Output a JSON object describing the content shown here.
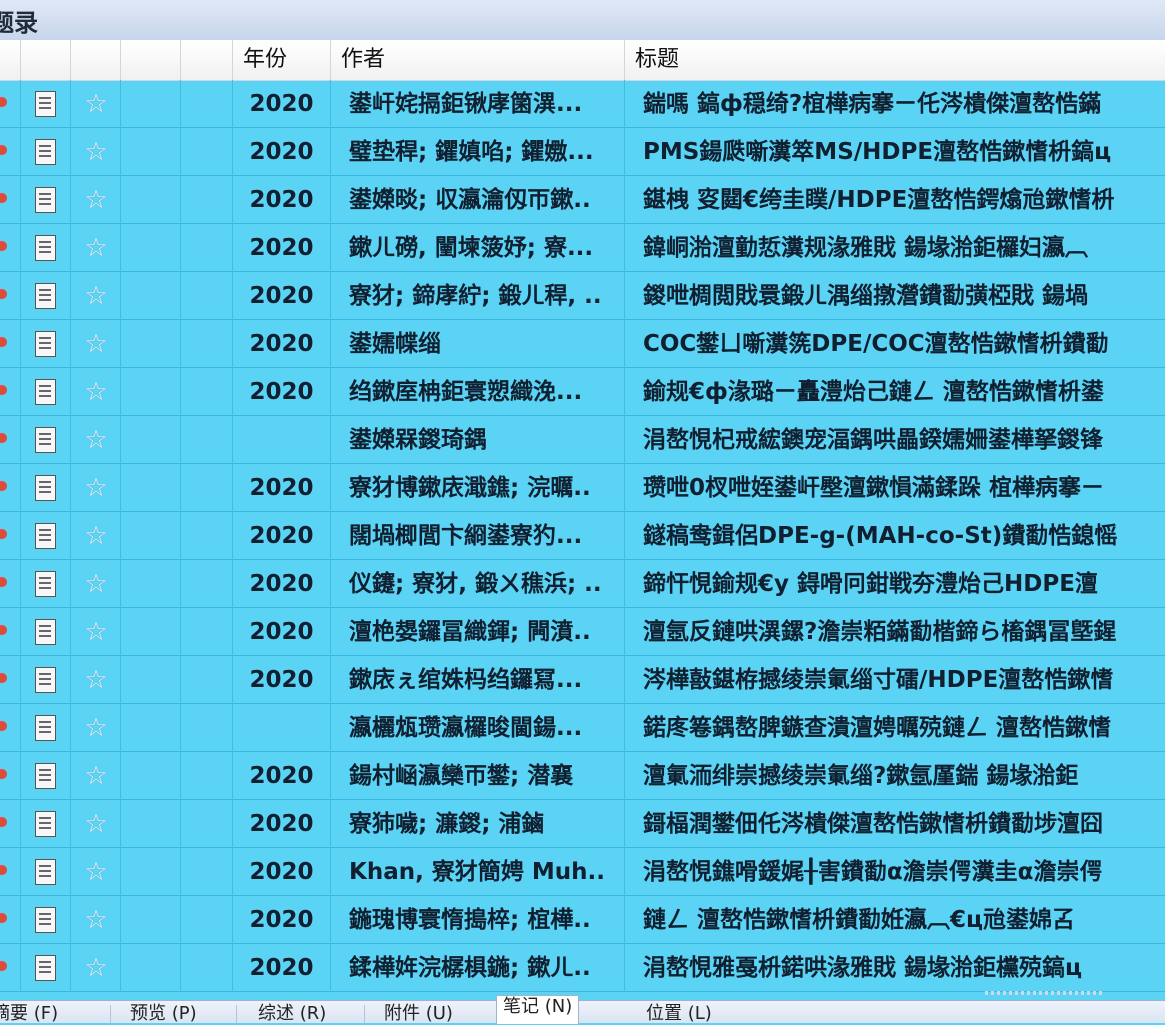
{
  "window": {
    "title": "题录"
  },
  "columns": {
    "year": "年份",
    "author": "作者",
    "title": "标题"
  },
  "icons": {
    "dot": "record-dot-icon",
    "doc": "document-icon",
    "star": "star-icon"
  },
  "rows": [
    {
      "year": "2020",
      "author": "鍙屽姹搹鉅锹庨箘潩...",
      "title": "鍴嗎   鎬ф穏绮?椬樺病搴ㄧ仛涔樻傑澶嶅悎鏋"
    },
    {
      "year": "2020",
      "author": "璧垫稈; 鑺嫃啗; 鑺嫐...",
      "title": "PMS鍚瓞噺瀵箤MS/HDPE澶嶅悎鏉愭枡鎬ц"
    },
    {
      "year": "2020",
      "author": "鍙嬫晱; 収瀛瀹仭帀鏉..",
      "title": "鍖栧 叜閮€绔圭瞨/HDPE澶嶅悎鍔熻兘鏉愭枡"
    },
    {
      "year": "2020",
      "author": "鏉ㄦ磱, 闉堜箥妤; 寮...",
      "title": "鍏峒湁澶勭悊瀵规湪雅戝   鍚堟湁鉅欏妇瀛︹"
    },
    {
      "year": "2020",
      "author": "寮犲; 鍗庨紵; 鍛ㄦ稈, ..",
      "title": "鍐呭椆閲戝睘鍛ㄦ湡缁撴瀯鐨勫彉椏戝   鍚堝"
    },
    {
      "year": "2020",
      "author": "鍙嬬幉缁",
      "title": "COC鐢ㄩ噺瀵箲DPE/COC澶嶅悎鏉愭枡鐨勫"
    },
    {
      "year": "2020",
      "author": "绉鏉庢柟鉅寰愬織浼...",
      "title": "鍮规€ф湪璐ㄧ矗澧炲己鏈ㄥ   澶嶅悎鏉愭枡鍙"
    },
    {
      "year": "",
      "author": "鍙嬫槑鍐琦鍝",
      "title": "涓嶅悓杞戒綋鐭宠湢鍝哄畾鍨嬬姍鍙樺拏鍐锋"
    },
    {
      "year": "2020",
      "author": "寮犲博鏉庡濈鐎; 浣曞..",
      "title": "瓒呭0杈呭姪鍙屽壂澶鏉愪滿鍒跺   椬樺病搴ㄧ"
    },
    {
      "year": "2020",
      "author": "闊堝楖閭卞綗鍙寮犳...",
      "title": "鐩稿鸯鍓侶DPE-g-(MAH-co-St)鐨勫悎鎴愮"
    },
    {
      "year": "2020",
      "author": "仪鑳; 寮犲, 鍛ㄨ穛浜; ..",
      "title": "鍗忓悓鍮规€у   鍀嗗冋鉗戦夯澧炲己HDPE澶"
    },
    {
      "year": "2020",
      "author": "澶栬嫢鑼冨織鍕; 闁濆..",
      "title": "澶氬反鏈哄潩鏍?澹崇粨鏋勫楷鍗ら槒鍝冨墍鍟"
    },
    {
      "year": "2020",
      "author": "鏉庡ぇ绾姝杩绉鑼冩...",
      "title": "涔樺敼鍖栫撼绫崇氭缁寸礌/HDPE澶嶅悎鏉愭"
    },
    {
      "year": "",
      "author": "瀛欐瓭瓒瀛欏晙閫鍚...",
      "title": "鍩庝箞鍝嶅脾鏃查潰澶娉曞殑鏈ㄥ   澶嶅悎鏉愭"
    },
    {
      "year": "2020",
      "author": "鍚村崡瀛欒帀鐢; 潜襄",
      "title": "澶氭洏绯崇撼绫崇氭缁?鏉氬厪鍴      鍚堟湁鉅"
    },
    {
      "year": "2020",
      "author": "寮犻噦; 濂鍐; 浦鏀",
      "title": "鎶楅潤鐢佃仛涔樻傑澶嶅悎鏉愭枡鐨勫埗澶囧"
    },
    {
      "year": "2020",
      "author": "Khan, 寮犲簡娉 Muh..",
      "title": "涓嶅悓鐎嗗鍰娓╂害鐨勫α澹崇偔瀵圭α澹崇偔"
    },
    {
      "year": "2020",
      "author": "鍦瑰博寰惰搗椊; 椬樺..",
      "title": "鏈ㄥ   澶嶅悎鏉愭枡鐨勫姙瀛︹€ц兘鍙婂叾"
    },
    {
      "year": "2020",
      "author": "鍒樺姩浣樼椇鍦; 鏉ㄦ..",
      "title": "涓嶅悓雅戞枡鍩哄湪雅戝   鍚堟湁鉅欓殑鎬ц"
    }
  ],
  "tabs": [
    {
      "label": "摘要 (F)"
    },
    {
      "label": "预览 (P)"
    },
    {
      "label": "综述 (R)"
    },
    {
      "label": "附件 (U)"
    },
    {
      "label": "笔记 (N)"
    },
    {
      "label": "位置 (L)"
    }
  ]
}
